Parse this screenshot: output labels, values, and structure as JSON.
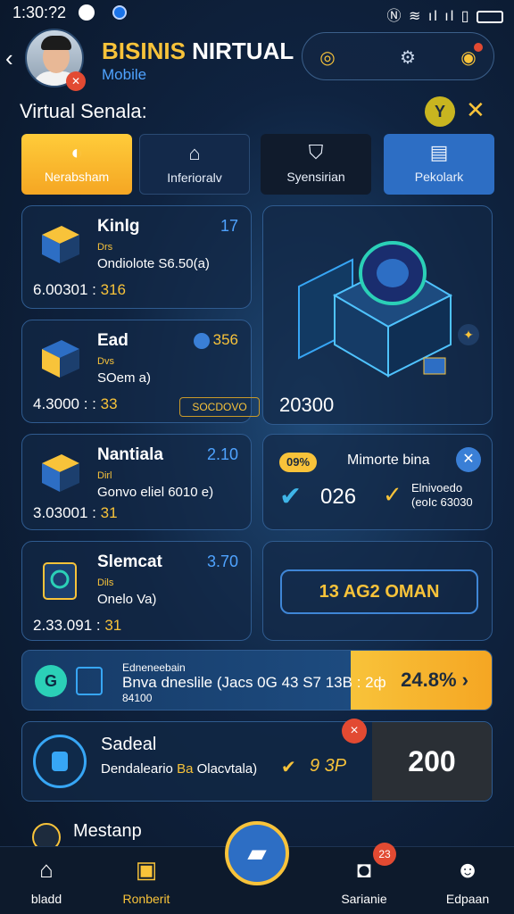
{
  "status": {
    "time": "1:30:?2",
    "icons": "Ⓝ ≋ ıl ıl ▯"
  },
  "header": {
    "title_a": "BISINIS",
    "title_b": " NIRTUAL",
    "subtitle": "Mobile"
  },
  "section_title": "Virtual Senala:",
  "tabs": [
    {
      "label": "Nerabsham",
      "icon": "hand-coin-icon"
    },
    {
      "label": "Inferioralv",
      "icon": "building-icon"
    },
    {
      "label": "Syensirian",
      "icon": "cart-icon"
    },
    {
      "label": "Pekolark",
      "icon": "chat-icon"
    }
  ],
  "cards": [
    {
      "name": "Kinlg",
      "count": "17",
      "tag": "Drs",
      "sub": "Ondiolote S6.50(a)",
      "value": "6.00301 : ",
      "highlight": "316"
    },
    {
      "name": "Ead",
      "count": "356",
      "tag": "Dvs",
      "sub": "SOem a)",
      "value": "4.3000 : : ",
      "highlight": "33",
      "badge": "SOCDOVO"
    },
    {
      "name": "Nantiala",
      "count": "2.10",
      "tag": "Dirl",
      "sub": "Gonvo eliel 6010 e)",
      "value": "3.03001 : ",
      "highlight": "31"
    },
    {
      "name": "Slemcat",
      "count": "3.70",
      "tag": "Dils",
      "sub": "Onelo Va)",
      "value": "2.33.091 : ",
      "highlight": "31"
    }
  ],
  "big_card": {
    "value": "20300"
  },
  "mini": {
    "pill": "09%",
    "title": "Mimorte bina",
    "value": "026",
    "line1": "Elnivoedo",
    "line2": "(eoIc 63030"
  },
  "outline_button": "13 AG2 OMAN",
  "banner": {
    "line1": "Edneneebain",
    "line2": "Bnva dneslile (Jacs 0G 43 S7 13B : 2ф",
    "line3": "84100",
    "percent": "24.8% ›"
  },
  "sa_card": {
    "name": "Sadeal",
    "desc_a": "Dendaleario ",
    "desc_b": "Ba",
    "desc_c": " Olacvtala)",
    "mark": "✔",
    "mark_value": "9 3P",
    "badge": "×",
    "amount": "200"
  },
  "bottom_item": "Mestanp",
  "nav": [
    {
      "label": "bladd",
      "icon": "home-icon"
    },
    {
      "label": "Ronberit",
      "icon": "shop-icon"
    },
    {
      "label": "Sarianie",
      "icon": "bag-icon"
    },
    {
      "label": "Edpaan",
      "icon": "user-icon"
    }
  ],
  "nav_badge": "23"
}
